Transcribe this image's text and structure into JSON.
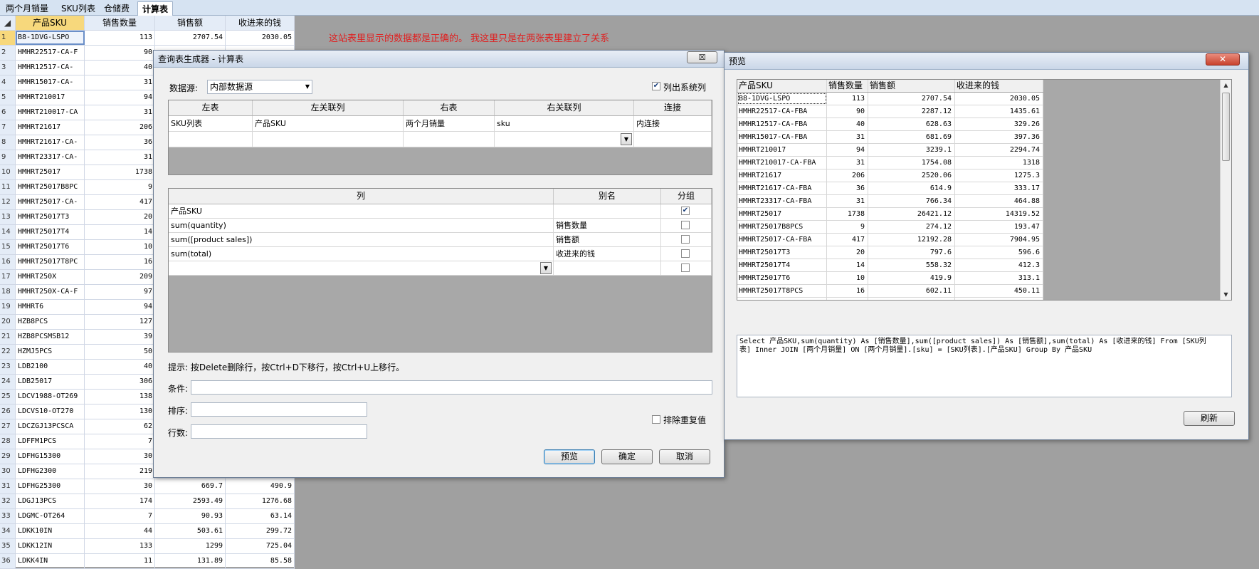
{
  "sheet_tabs": [
    "两个月销量",
    "SKU列表",
    "仓储费",
    "计算表"
  ],
  "active_tab": "计算表",
  "sheet": {
    "corner_label": "◢",
    "columns": [
      "产品SKU",
      "销售数量",
      "销售额",
      "收进来的钱"
    ],
    "rows": [
      {
        "idx": "1",
        "sku": "B8-1DVG-LSPO",
        "qty": "113",
        "amt": "2707.54",
        "in": "2030.05"
      },
      {
        "idx": "2",
        "sku": "HMHR22517-CA-F",
        "qty": "90",
        "amt": "",
        "in": ""
      },
      {
        "idx": "3",
        "sku": "HMHR12517-CA-",
        "qty": "40",
        "amt": "",
        "in": ""
      },
      {
        "idx": "4",
        "sku": "HMHR15017-CA-",
        "qty": "31",
        "amt": "",
        "in": ""
      },
      {
        "idx": "5",
        "sku": "HMHRT210017",
        "qty": "94",
        "amt": "",
        "in": ""
      },
      {
        "idx": "6",
        "sku": "HMHRT210017-CA",
        "qty": "31",
        "amt": "",
        "in": ""
      },
      {
        "idx": "7",
        "sku": "HMHRT21617",
        "qty": "206",
        "amt": "",
        "in": ""
      },
      {
        "idx": "8",
        "sku": "HMHRT21617-CA-",
        "qty": "36",
        "amt": "",
        "in": ""
      },
      {
        "idx": "9",
        "sku": "HMHRT23317-CA-",
        "qty": "31",
        "amt": "",
        "in": ""
      },
      {
        "idx": "10",
        "sku": "HMHRT25017",
        "qty": "1738",
        "amt": "",
        "in": ""
      },
      {
        "idx": "11",
        "sku": "HMHRT25017B8PC",
        "qty": "9",
        "amt": "",
        "in": ""
      },
      {
        "idx": "12",
        "sku": "HMHRT25017-CA-",
        "qty": "417",
        "amt": "",
        "in": ""
      },
      {
        "idx": "13",
        "sku": "HMHRT25017T3",
        "qty": "20",
        "amt": "",
        "in": ""
      },
      {
        "idx": "14",
        "sku": "HMHRT25017T4",
        "qty": "14",
        "amt": "",
        "in": ""
      },
      {
        "idx": "15",
        "sku": "HMHRT25017T6",
        "qty": "10",
        "amt": "",
        "in": ""
      },
      {
        "idx": "16",
        "sku": "HMHRT25017T8PC",
        "qty": "16",
        "amt": "",
        "in": ""
      },
      {
        "idx": "17",
        "sku": "HMHRT250X",
        "qty": "209",
        "amt": "",
        "in": ""
      },
      {
        "idx": "18",
        "sku": "HMHRT250X-CA-F",
        "qty": "97",
        "amt": "",
        "in": ""
      },
      {
        "idx": "19",
        "sku": "HMHRT6",
        "qty": "94",
        "amt": "",
        "in": ""
      },
      {
        "idx": "20",
        "sku": "HZB8PCS",
        "qty": "127",
        "amt": "",
        "in": ""
      },
      {
        "idx": "21",
        "sku": "HZB8PCSMSB12",
        "qty": "39",
        "amt": "",
        "in": ""
      },
      {
        "idx": "22",
        "sku": "HZMJ5PCS",
        "qty": "50",
        "amt": "",
        "in": ""
      },
      {
        "idx": "23",
        "sku": "LDB2100",
        "qty": "40",
        "amt": "",
        "in": ""
      },
      {
        "idx": "24",
        "sku": "LDB25017",
        "qty": "306",
        "amt": "",
        "in": ""
      },
      {
        "idx": "25",
        "sku": "LDCV1988-OT269",
        "qty": "138",
        "amt": "",
        "in": ""
      },
      {
        "idx": "26",
        "sku": "LDCVS10-OT270",
        "qty": "130",
        "amt": "",
        "in": ""
      },
      {
        "idx": "27",
        "sku": "LDCZGJ13PCSCA",
        "qty": "62",
        "amt": "",
        "in": ""
      },
      {
        "idx": "28",
        "sku": "LDFFM1PCS",
        "qty": "7",
        "amt": "",
        "in": ""
      },
      {
        "idx": "29",
        "sku": "LDFHG15300",
        "qty": "30",
        "amt": "",
        "in": ""
      },
      {
        "idx": "30",
        "sku": "LDFHG2300",
        "qty": "219",
        "amt": "",
        "in": ""
      },
      {
        "idx": "31",
        "sku": "LDFHG25300",
        "qty": "30",
        "amt": "669.7",
        "in": "490.9"
      },
      {
        "idx": "32",
        "sku": "LDGJ13PCS",
        "qty": "174",
        "amt": "2593.49",
        "in": "1276.68"
      },
      {
        "idx": "33",
        "sku": "LDGMC-OT264",
        "qty": "7",
        "amt": "90.93",
        "in": "63.14"
      },
      {
        "idx": "34",
        "sku": "LDKK10IN",
        "qty": "44",
        "amt": "503.61",
        "in": "299.72"
      },
      {
        "idx": "35",
        "sku": "LDKK12IN",
        "qty": "133",
        "amt": "1299",
        "in": "725.04"
      },
      {
        "idx": "36",
        "sku": "LDKK4IN",
        "qty": "11",
        "amt": "131.89",
        "in": "85.58"
      }
    ]
  },
  "note": "这站表里显示的数据都是正确的。 我这里只是在两张表里建立了关系",
  "query_dialog": {
    "title": "查询表生成器 - 计算表",
    "close_glyph": "☒",
    "datasource_label": "数据源:",
    "datasource_value": "内部数据源",
    "list_system_columns_label": "列出系统列",
    "list_system_columns_checked": true,
    "join_headers": [
      "左表",
      "左关联列",
      "右表",
      "右关联列",
      "连接"
    ],
    "join_rows": [
      {
        "left": "SKU列表",
        "left_col": "产品SKU",
        "right": "两个月销量",
        "right_col": "sku",
        "join": "内连接"
      }
    ],
    "col_headers": [
      "列",
      "别名",
      "分组"
    ],
    "col_rows": [
      {
        "col": "产品SKU",
        "alias": "",
        "group": true
      },
      {
        "col": "sum(quantity)",
        "alias": "销售数量",
        "group": false
      },
      {
        "col": "sum([product sales])",
        "alias": "销售额",
        "group": false
      },
      {
        "col": "sum(total)",
        "alias": "收进来的钱",
        "group": false
      },
      {
        "col": "",
        "alias": "",
        "group": false
      }
    ],
    "hint": "提示: 按Delete删除行，按Ctrl+D下移行，按Ctrl+U上移行。",
    "condition_label": "条件:",
    "sort_label": "排序:",
    "rows_label": "行数:",
    "distinct_label": "排除重复值",
    "preview_btn": "预览",
    "ok_btn": "确定",
    "cancel_btn": "取消"
  },
  "preview_dialog": {
    "title": "预览",
    "close_glyph": "✕",
    "headers": [
      "产品SKU",
      "销售数量",
      "销售额",
      "收进来的钱"
    ],
    "rows": [
      {
        "sku": "B8-1DVG-LSPO",
        "qty": "113",
        "amt": "2707.54",
        "in": "2030.05"
      },
      {
        "sku": "HMHR22517-CA-FBA",
        "qty": "90",
        "amt": "2287.12",
        "in": "1435.61"
      },
      {
        "sku": "HMHR12517-CA-FBA",
        "qty": "40",
        "amt": "628.63",
        "in": "329.26"
      },
      {
        "sku": "HMHR15017-CA-FBA",
        "qty": "31",
        "amt": "681.69",
        "in": "397.36"
      },
      {
        "sku": "HMHRT210017",
        "qty": "94",
        "amt": "3239.1",
        "in": "2294.74"
      },
      {
        "sku": "HMHRT210017-CA-FBA",
        "qty": "31",
        "amt": "1754.08",
        "in": "1318"
      },
      {
        "sku": "HMHRT21617",
        "qty": "206",
        "amt": "2520.06",
        "in": "1275.3"
      },
      {
        "sku": "HMHRT21617-CA-FBA",
        "qty": "36",
        "amt": "614.9",
        "in": "333.17"
      },
      {
        "sku": "HMHRT23317-CA-FBA",
        "qty": "31",
        "amt": "766.34",
        "in": "464.88"
      },
      {
        "sku": "HMHRT25017",
        "qty": "1738",
        "amt": "26421.12",
        "in": "14319.52"
      },
      {
        "sku": "HMHRT25017B8PCS",
        "qty": "9",
        "amt": "274.12",
        "in": "193.47"
      },
      {
        "sku": "HMHRT25017-CA-FBA",
        "qty": "417",
        "amt": "12192.28",
        "in": "7904.95"
      },
      {
        "sku": "HMHRT25017T3",
        "qty": "20",
        "amt": "797.6",
        "in": "596.6"
      },
      {
        "sku": "HMHRT25017T4",
        "qty": "14",
        "amt": "558.32",
        "in": "412.3"
      },
      {
        "sku": "HMHRT25017T6",
        "qty": "10",
        "amt": "419.9",
        "in": "313.1"
      },
      {
        "sku": "HMHRT25017T8PCS",
        "qty": "16",
        "amt": "602.11",
        "in": "450.11"
      },
      {
        "sku": "HMHRT250X",
        "qty": "209",
        "amt": "4177.01",
        "in": "2599.98"
      },
      {
        "sku": "HMHRT250X-CA-FBA",
        "qty": "97",
        "amt": "3028.6",
        "in": "2001.13"
      }
    ],
    "sql_line1": "Select  产品SKU,sum(quantity) As [销售数量],sum([product sales]) As [销售额],sum(total) As [收进来的钱] From [SKU列",
    "sql_line2": "表] Inner JOIN [两个月销量] ON [两个月销量].[sku] = [SKU列表].[产品SKU] Group By 产品SKU",
    "refresh_btn": "刷新"
  }
}
